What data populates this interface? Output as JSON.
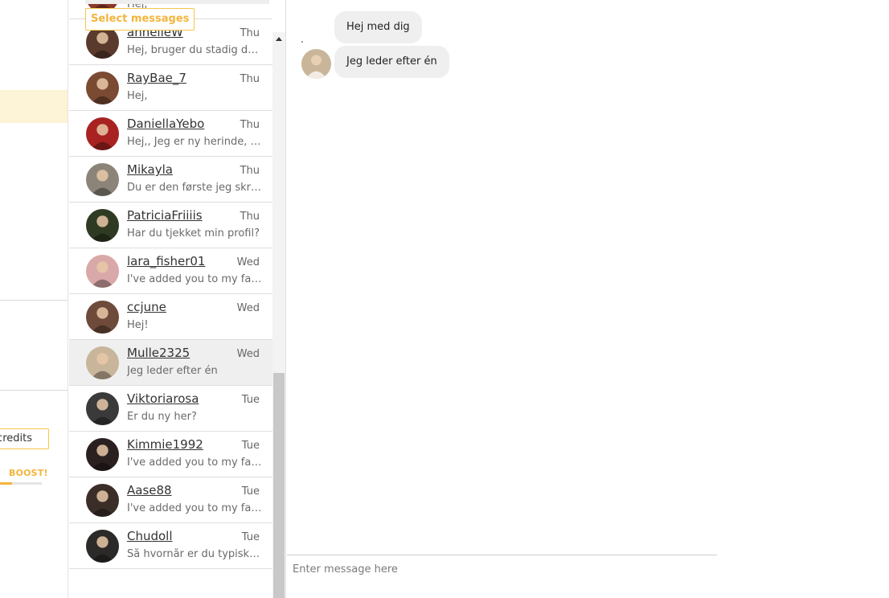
{
  "leftnav": {
    "credits_label": "credits",
    "boost_label": "BOOST!",
    "boost_progress": 0.28
  },
  "conversations": {
    "select_button": "Select messages",
    "items": [
      {
        "name": "",
        "time": "",
        "preview": "Hej,",
        "avatar_color": "#8a3a2a"
      },
      {
        "name": "annelieW",
        "time": "Thu",
        "preview": "Hej, bruger du stadig den her app?",
        "avatar_color": "#5a3a2c"
      },
      {
        "name": "RayBae_7",
        "time": "Thu",
        "preview": "Hej,",
        "avatar_color": "#7a4a32"
      },
      {
        "name": "DaniellaYebo",
        "time": "Thu",
        "preview": "Hej,, Jeg er ny herinde, hvad med dig?",
        "avatar_color": "#a82222"
      },
      {
        "name": "Mikayla",
        "time": "Thu",
        "preview": "Du er den første jeg skriver til",
        "avatar_color": "#8c8478"
      },
      {
        "name": "PatriciaFriiiis",
        "time": "Thu",
        "preview": "Har du tjekket min profil?",
        "avatar_color": "#2f3a22"
      },
      {
        "name": "lara_fisher01",
        "time": "Wed",
        "preview": "I've added you to my favorites",
        "avatar_color": "#d9a8a8"
      },
      {
        "name": "ccjune",
        "time": "Wed",
        "preview": "Hej!",
        "avatar_color": "#6e4a3a"
      },
      {
        "name": "Mulle2325",
        "time": "Wed",
        "preview": "Jeg leder efter én",
        "avatar_color": "#c9b59a"
      },
      {
        "name": "Viktoriarosa",
        "time": "Tue",
        "preview": "Er du ny her?",
        "avatar_color": "#3a3a3a"
      },
      {
        "name": "Kimmie1992",
        "time": "Tue",
        "preview": "I've added you to my favorites",
        "avatar_color": "#2a2020"
      },
      {
        "name": "Aase88",
        "time": "Tue",
        "preview": "I've added you to my favorites",
        "avatar_color": "#3b2e28"
      },
      {
        "name": "Chudoll",
        "time": "Tue",
        "preview": "Så hvornår er du typisk logget ind?",
        "avatar_color": "#2c2a28"
      }
    ],
    "active_index": 8
  },
  "chat": {
    "messages": [
      {
        "text": "Hej med dig"
      },
      {
        "text": "Jeg leder efter én"
      }
    ],
    "avatar_color": "#c9b59a",
    "composer_placeholder": "Enter message here"
  }
}
